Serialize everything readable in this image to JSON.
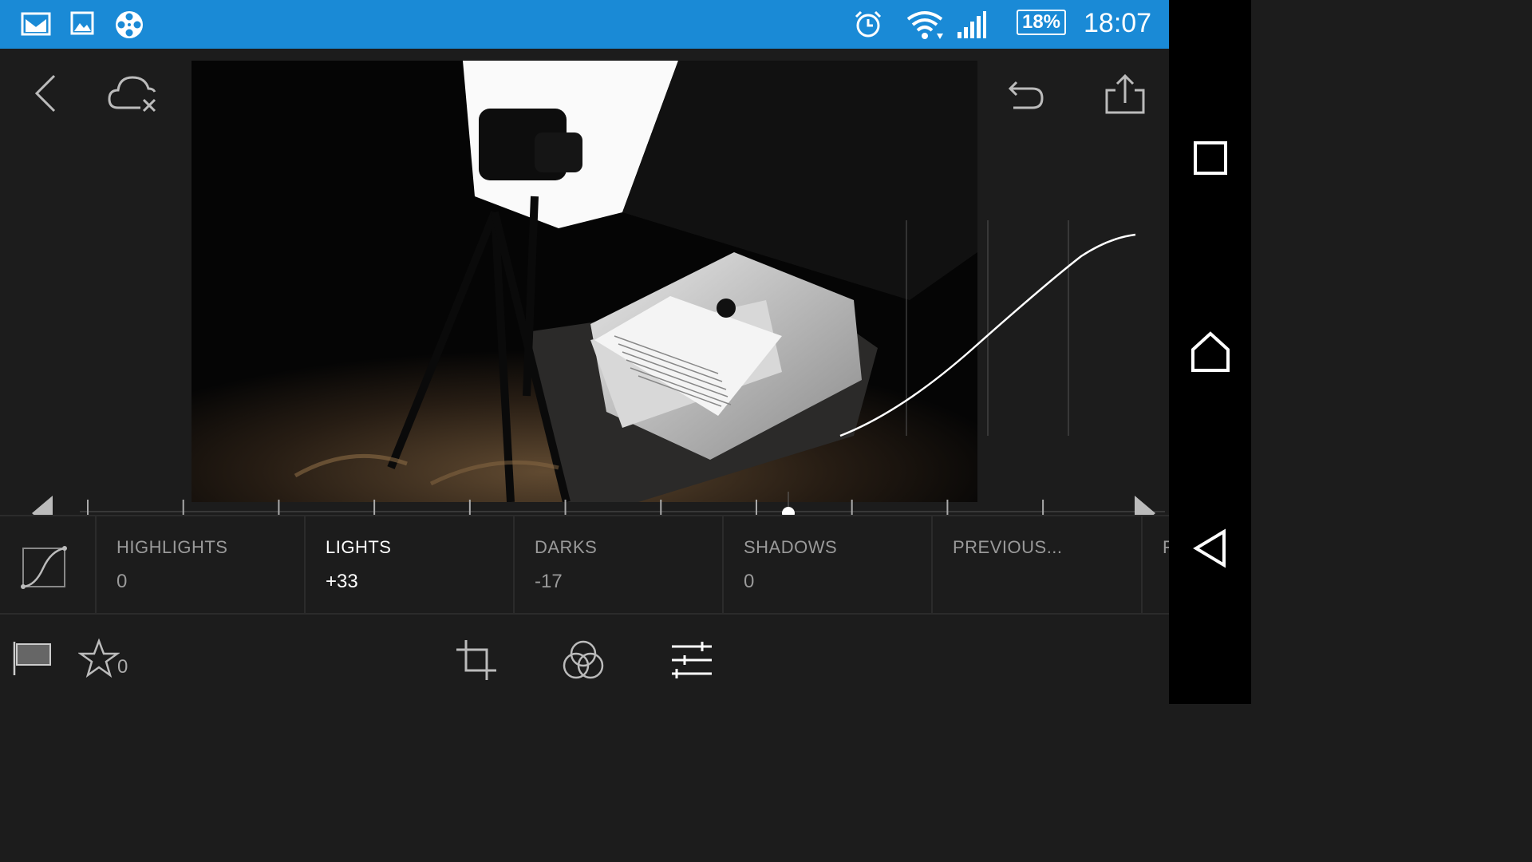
{
  "status_bar": {
    "battery": "18%",
    "time": "18:07"
  },
  "tools": [
    {
      "label": "HIGHLIGHTS",
      "value": "0"
    },
    {
      "label": "LIGHTS",
      "value": "+33"
    },
    {
      "label": "DARKS",
      "value": "-17"
    },
    {
      "label": "SHADOWS",
      "value": "0"
    },
    {
      "label": "PREVIOUS...",
      "value": ""
    },
    {
      "label": "F",
      "value": ""
    }
  ],
  "bottom_bar": {
    "star_count": "0"
  },
  "icons": {
    "statusbar": [
      "gmail-icon",
      "gallery-icon",
      "film-reel-icon",
      "alarm-icon",
      "wifi-icon",
      "signal-icon",
      "battery-icon"
    ],
    "top": [
      "back-icon",
      "cloud-off-icon",
      "undo-icon",
      "share-icon"
    ],
    "bottom": [
      "flag-icon",
      "star-icon",
      "crop-icon",
      "color-circles-icon",
      "adjust-sliders-icon"
    ],
    "nav": [
      "recent-apps-icon",
      "home-icon",
      "back-nav-icon"
    ]
  },
  "colors": {
    "status_bar": "#1a8ad6",
    "background": "#1c1c1c",
    "active_text": "#ffffff",
    "inactive_text": "#9a9a9a"
  },
  "slider_position": 0.7
}
